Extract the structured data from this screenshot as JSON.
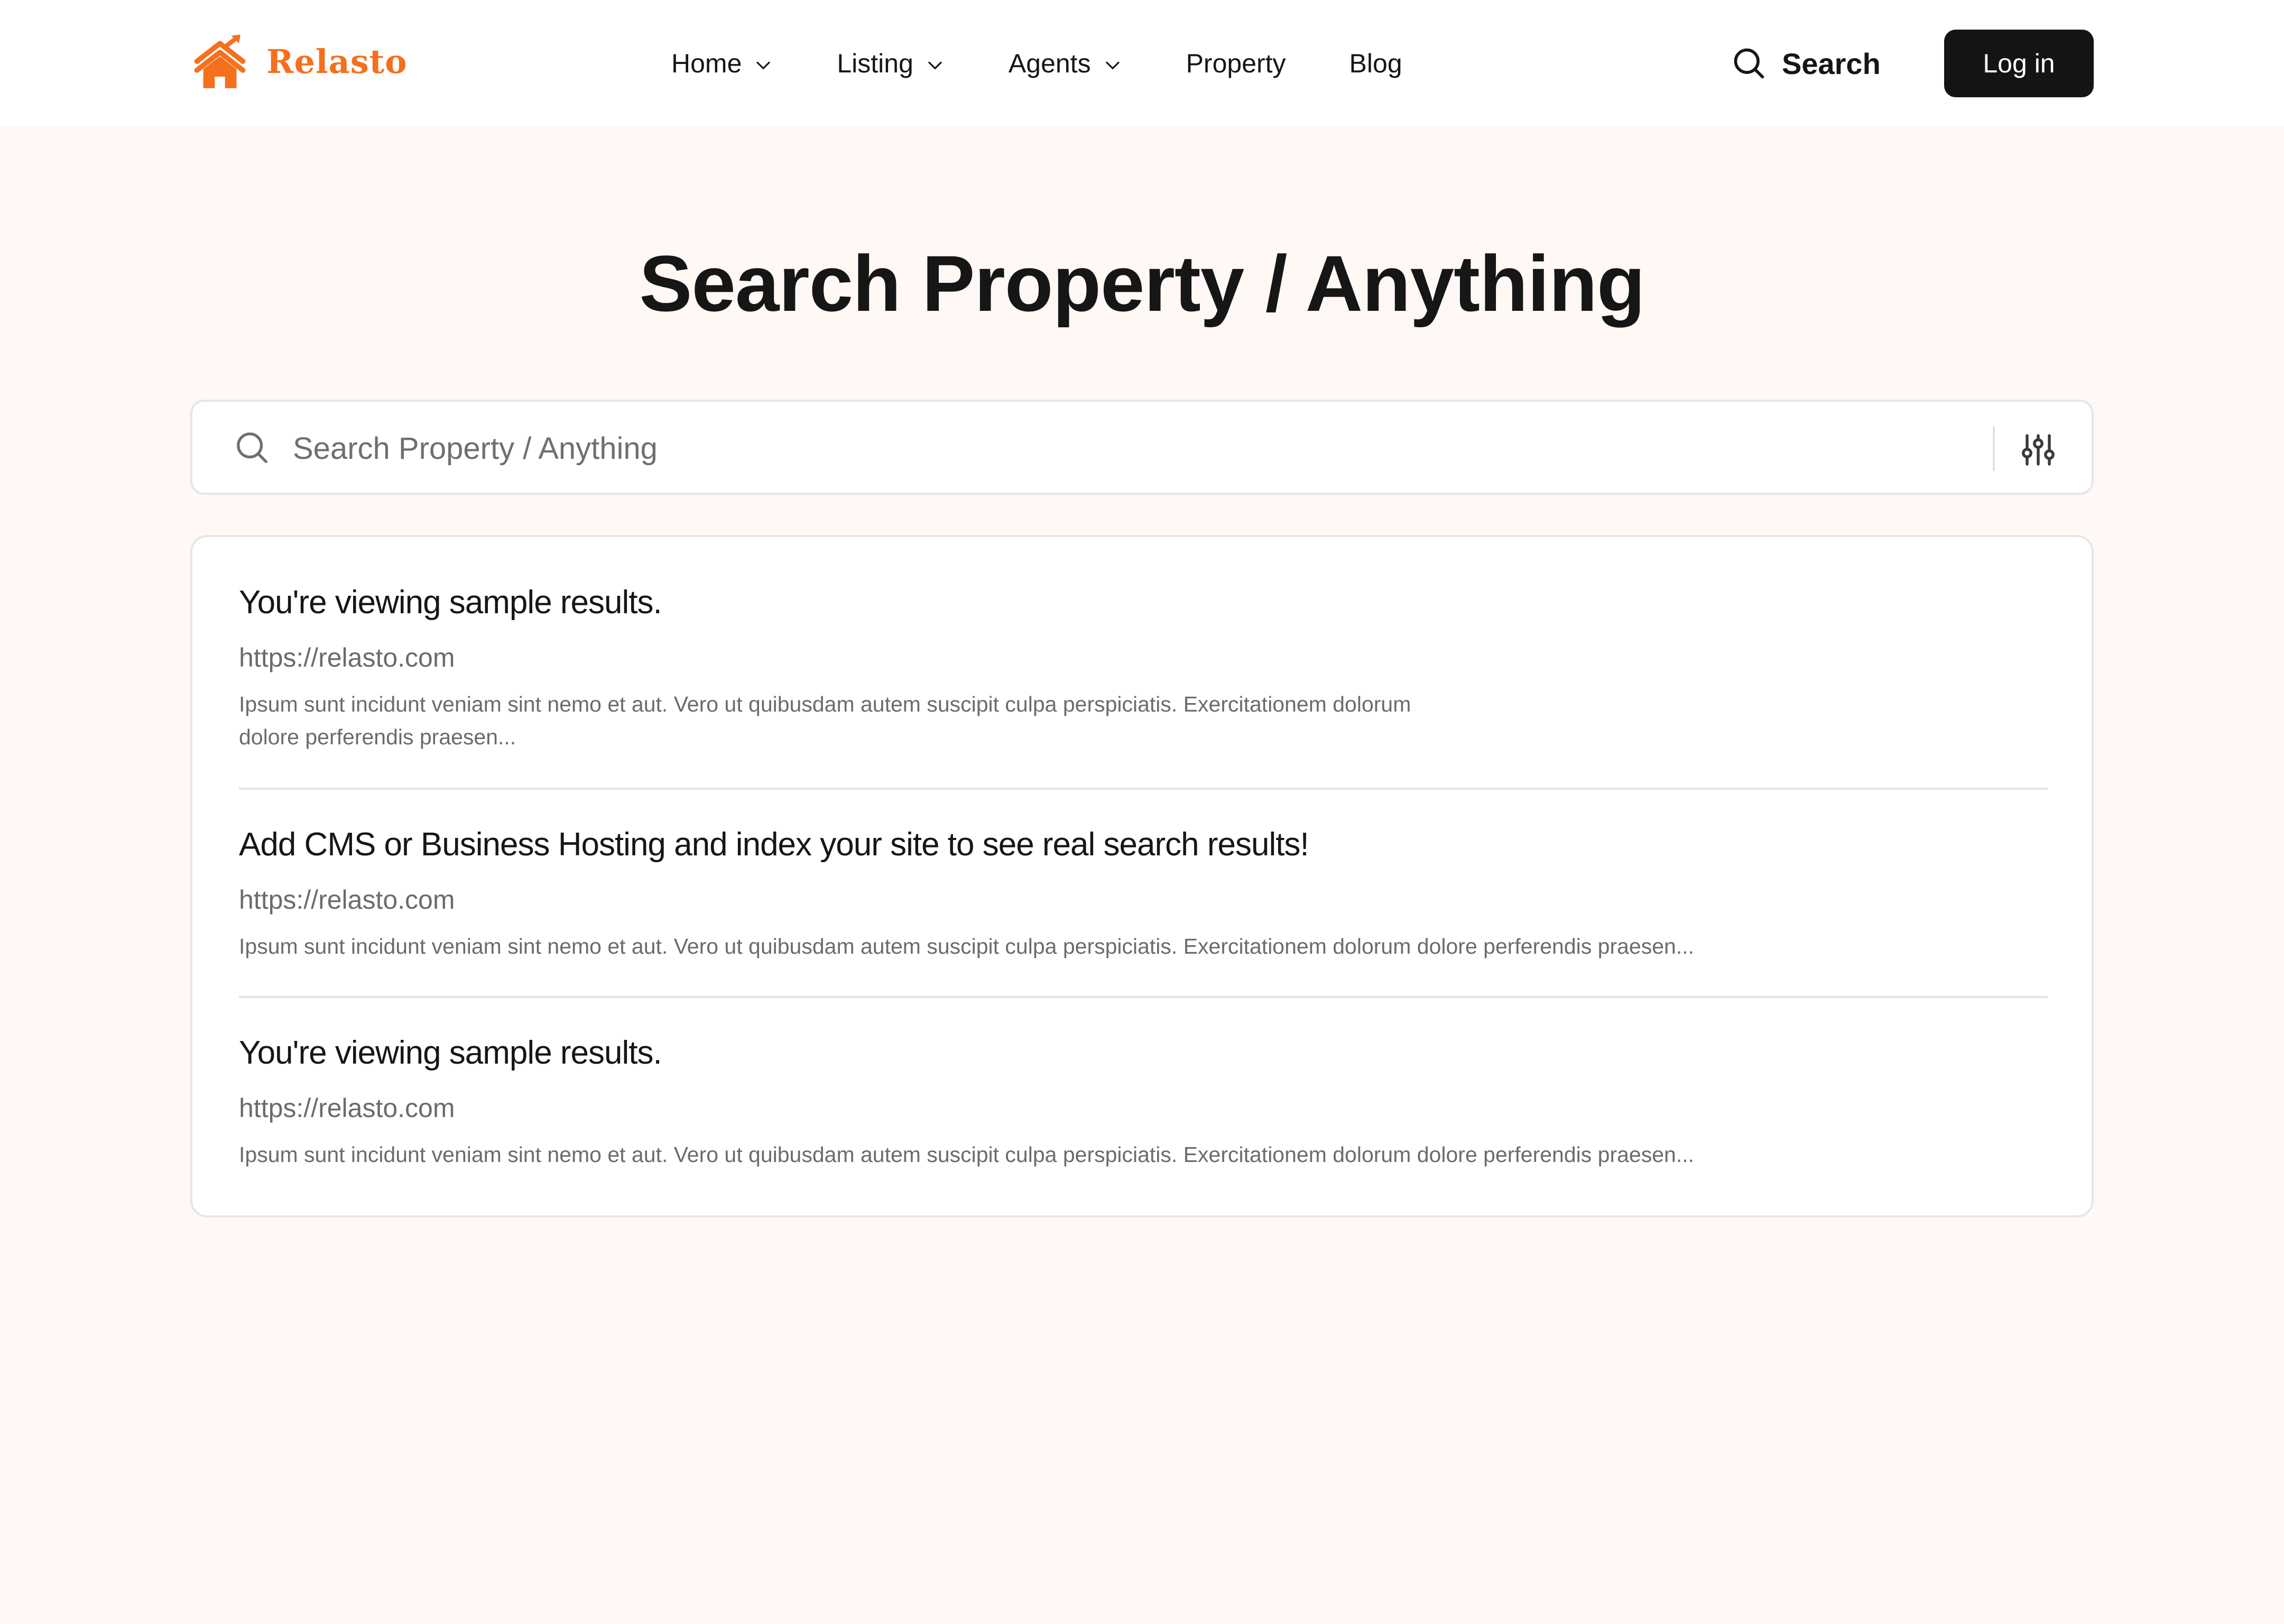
{
  "header": {
    "logo_text": "Relasto",
    "nav": [
      {
        "label": "Home",
        "has_dropdown": true
      },
      {
        "label": "Listing",
        "has_dropdown": true
      },
      {
        "label": "Agents",
        "has_dropdown": true
      },
      {
        "label": "Property",
        "has_dropdown": false
      },
      {
        "label": "Blog",
        "has_dropdown": false
      }
    ],
    "search_label": "Search",
    "login_label": "Log in"
  },
  "main": {
    "title": "Search Property / Anything",
    "search": {
      "placeholder": "Search Property / Anything",
      "value": ""
    },
    "results": [
      {
        "title": "You're viewing sample results.",
        "url": "https://relasto.com",
        "description": "Ipsum sunt incidunt veniam sint nemo et aut. Vero ut quibusdam autem suscipit culpa perspiciatis. Exercitationem dolorum dolore perferendis praesen..."
      },
      {
        "title": "Add CMS or Business Hosting and index your site to see real search results!",
        "url": "https://relasto.com",
        "description": "Ipsum sunt incidunt veniam sint nemo et aut. Vero ut quibusdam autem suscipit culpa perspiciatis. Exercitationem dolorum dolore perferendis praesen..."
      },
      {
        "title": "You're viewing sample results.",
        "url": "https://relasto.com",
        "description": "Ipsum sunt incidunt veniam sint nemo et aut. Vero ut quibusdam autem suscipit culpa perspiciatis. Exercitationem dolorum dolore perferendis praesen..."
      }
    ]
  },
  "colors": {
    "brand": "#f4701d",
    "page_background": "#fff8f5",
    "button_dark": "#141414",
    "text_primary": "#161616",
    "text_muted": "#6b6b6b"
  },
  "icons": {
    "logo": "house-with-trend-arrow-icon",
    "nav_dropdown": "chevron-down-icon",
    "search": "search-icon",
    "filter": "sliders-icon"
  }
}
